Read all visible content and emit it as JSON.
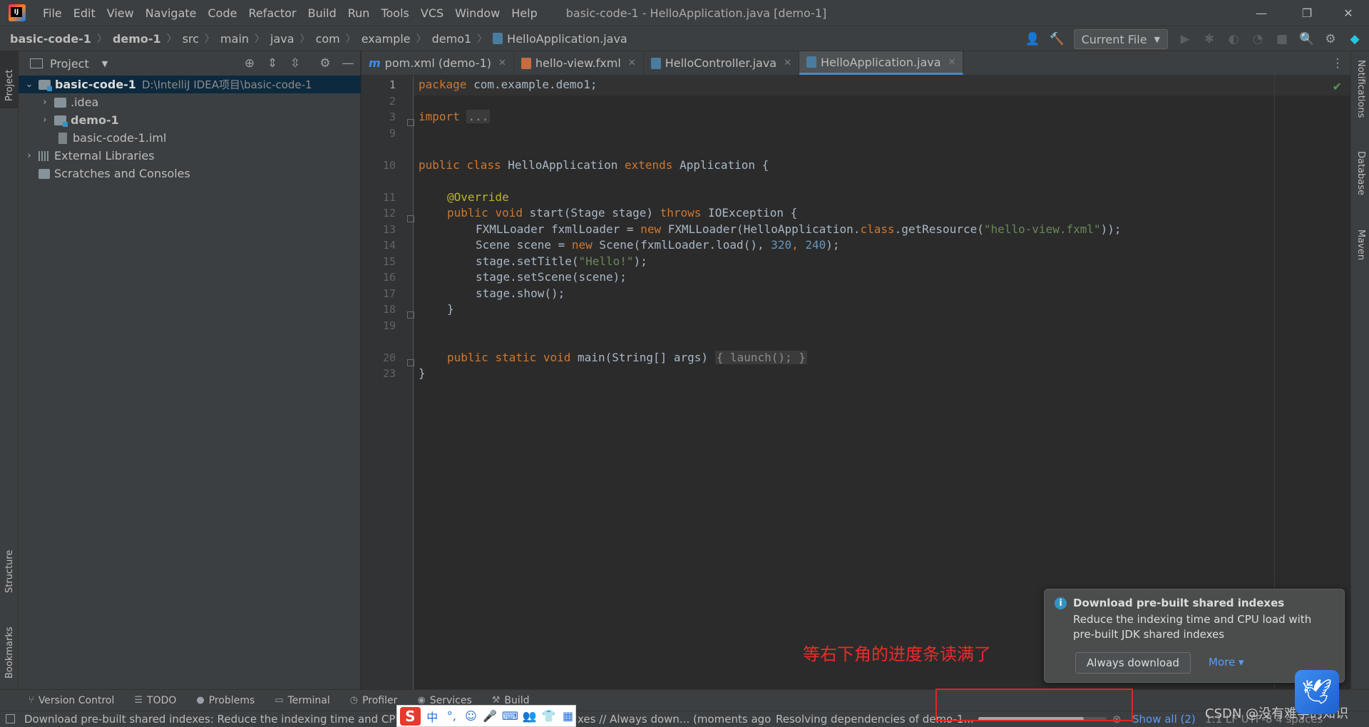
{
  "window": {
    "title": "basic-code-1 - HelloApplication.java [demo-1]",
    "controls": [
      "—",
      "❐",
      "✕"
    ]
  },
  "menu": [
    "File",
    "Edit",
    "View",
    "Navigate",
    "Code",
    "Refactor",
    "Build",
    "Run",
    "Tools",
    "VCS",
    "Window",
    "Help"
  ],
  "breadcrumb": [
    "basic-code-1",
    "demo-1",
    "src",
    "main",
    "java",
    "com",
    "example",
    "demo1",
    "HelloApplication.java"
  ],
  "toolbar": {
    "run_config": "Current File"
  },
  "left_stripe": {
    "project": "Project",
    "structure": "Structure",
    "bookmarks": "Bookmarks"
  },
  "right_stripe": {
    "notifications": "Notifications",
    "database": "Database",
    "maven": "Maven"
  },
  "project_panel": {
    "title": "Project",
    "tree": [
      {
        "label": "basic-code-1",
        "path": "D:\\IntelliJ IDEA项目\\basic-code-1"
      },
      {
        "label": ".idea"
      },
      {
        "label": "demo-1"
      },
      {
        "label": "basic-code-1.iml"
      },
      {
        "label": "External Libraries"
      },
      {
        "label": "Scratches and Consoles"
      }
    ]
  },
  "tabs": [
    {
      "label": "pom.xml (demo-1)"
    },
    {
      "label": "hello-view.fxml"
    },
    {
      "label": "HelloController.java"
    },
    {
      "label": "HelloApplication.java"
    }
  ],
  "line_numbers": [
    "1",
    "2",
    "3",
    "9",
    "10",
    "11",
    "12",
    "13",
    "14",
    "15",
    "16",
    "17",
    "18",
    "19",
    "20",
    "23"
  ],
  "code": {
    "l1_kw": "package",
    "l1_rest": " com.example.demo1;",
    "l3_kw": "import",
    "l3_fold": "...",
    "l10_kw1": "public",
    "l10_kw2": "class",
    "l10_name": " HelloApplication ",
    "l10_kw3": "extends",
    "l10_rest": " Application {",
    "l11": "@Override",
    "l12_kw1": "public",
    "l12_kw2": "void",
    "l12_mid": " start(Stage stage) ",
    "l12_kw3": "throws",
    "l12_rest": " IOException {",
    "l13_a": "FXMLLoader fxmlLoader = ",
    "l13_kw": "new",
    "l13_b": " FXMLLoader(HelloApplication.",
    "l13_kw2": "class",
    "l13_c": ".getResource(",
    "l13_str": "\"hello-view.fxml\"",
    "l13_d": "));",
    "l14_a": "Scene scene = ",
    "l14_kw": "new",
    "l14_b": " Scene(fxmlLoader.load(), ",
    "l14_n1": "320",
    "l14_c": ", ",
    "l14_n2": "240",
    "l14_d": ");",
    "l15_a": "stage.setTitle(",
    "l15_str": "\"Hello!\"",
    "l15_b": ");",
    "l16": "stage.setScene(scene);",
    "l17": "stage.show();",
    "l18": "}",
    "l20_kw1": "public",
    "l20_kw2": "static",
    "l20_kw3": "void",
    "l20_mid": " main(String[] args) ",
    "l20_fold": "{ launch(); }",
    "l23": "}"
  },
  "notification": {
    "title": "Download pre-built shared indexes",
    "body": "Reduce the indexing time and CPU load with pre-built JDK shared indexes",
    "primary": "Always download",
    "more": "More ▾"
  },
  "annotation_text": "等右下角的进度条读满了",
  "bottom_tools": [
    "Version Control",
    "TODO",
    "Problems",
    "Terminal",
    "Profiler",
    "Services",
    "Build"
  ],
  "status": {
    "message": "Download pre-built shared indexes: Reduce the indexing time and CPU l",
    "message2": "xes // Always down... (moments ago",
    "task": "Resolving dependencies of demo-1...",
    "progress": 0.82,
    "show_all": "Show all (2)",
    "right": "1:1  LF  UTF-8  4 spaces"
  },
  "ime": {
    "s": "S",
    "items": [
      "中",
      "°,",
      "☺",
      "🎤",
      "⌨",
      "👥",
      "👕",
      "▦"
    ]
  },
  "watermark": "CSDN @没有难学的知识"
}
